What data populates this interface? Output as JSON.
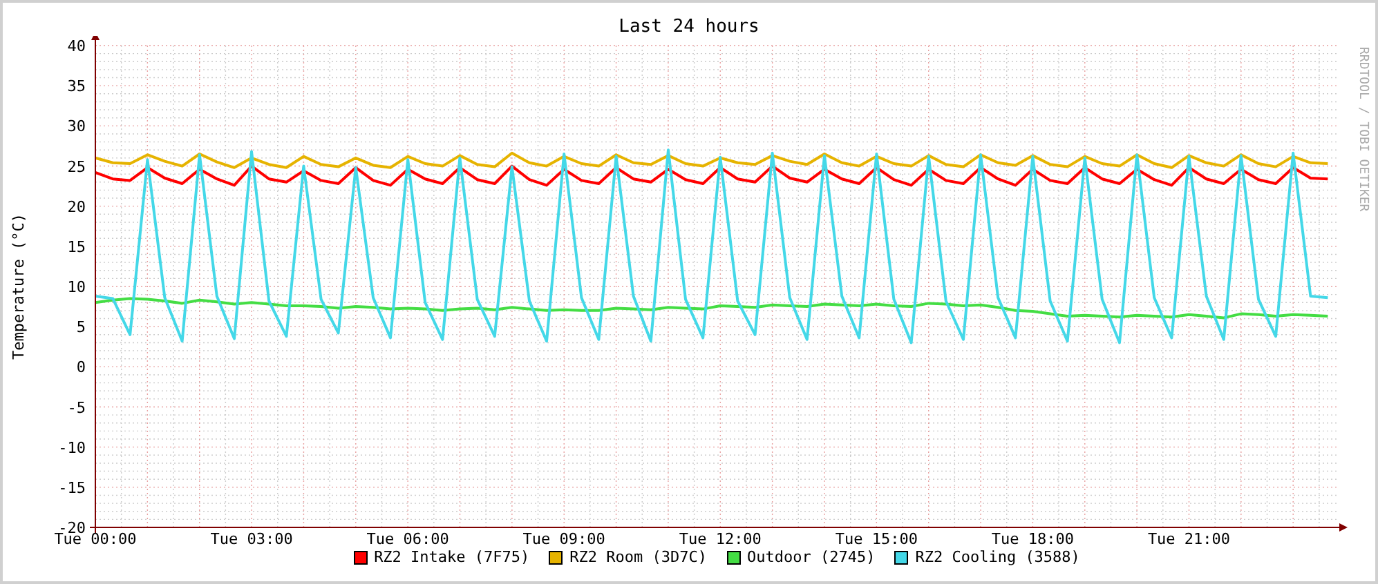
{
  "credit": "RRDTOOL / TOBI OETIKER",
  "chart_data": {
    "type": "line",
    "title": "Last 24 hours",
    "ylabel": "Temperature (°C)",
    "ylim": [
      -20,
      40
    ],
    "grid": true,
    "yticks": [
      -20,
      -15,
      -10,
      -5,
      0,
      5,
      10,
      15,
      20,
      25,
      30,
      35,
      40
    ],
    "categories": [
      "Tue 00:00",
      null,
      null,
      null,
      null,
      null,
      null,
      null,
      null,
      "Tue 03:00",
      null,
      null,
      null,
      null,
      null,
      null,
      null,
      null,
      "Tue 06:00",
      null,
      null,
      null,
      null,
      null,
      null,
      null,
      null,
      "Tue 09:00",
      null,
      null,
      null,
      null,
      null,
      null,
      null,
      null,
      "Tue 12:00",
      null,
      null,
      null,
      null,
      null,
      null,
      null,
      null,
      "Tue 15:00",
      null,
      null,
      null,
      null,
      null,
      null,
      null,
      null,
      "Tue 18:00",
      null,
      null,
      null,
      null,
      null,
      null,
      null,
      null,
      "Tue 21:00",
      null,
      null,
      null,
      null,
      null,
      null,
      null,
      null
    ],
    "series": [
      {
        "name": "RZ2 Intake (7F75)",
        "color": "#ff0000",
        "values": [
          24.2,
          23.4,
          23.2,
          24.8,
          23.5,
          22.8,
          24.6,
          23.4,
          22.6,
          25.0,
          23.4,
          23.0,
          24.4,
          23.2,
          22.8,
          24.8,
          23.2,
          22.6,
          24.6,
          23.4,
          22.8,
          24.8,
          23.3,
          22.8,
          25.0,
          23.3,
          22.6,
          24.6,
          23.2,
          22.8,
          24.8,
          23.4,
          23.0,
          24.6,
          23.3,
          22.8,
          24.8,
          23.4,
          23.0,
          25.0,
          23.5,
          23.0,
          24.6,
          23.4,
          22.8,
          24.8,
          23.3,
          22.6,
          24.6,
          23.2,
          22.8,
          24.8,
          23.4,
          22.6,
          24.6,
          23.2,
          22.8,
          24.8,
          23.4,
          22.8,
          24.6,
          23.3,
          22.6,
          24.8,
          23.4,
          22.8,
          24.6,
          23.3,
          22.8,
          24.8,
          23.5,
          23.4
        ]
      },
      {
        "name": "RZ2 Room (3D7C)",
        "color": "#e6b300",
        "values": [
          26.0,
          25.4,
          25.3,
          26.4,
          25.6,
          25.0,
          26.5,
          25.5,
          24.8,
          26.0,
          25.2,
          24.8,
          26.2,
          25.2,
          24.9,
          26.0,
          25.1,
          24.8,
          26.2,
          25.3,
          25.0,
          26.3,
          25.2,
          24.9,
          26.6,
          25.4,
          25.0,
          26.2,
          25.3,
          25.0,
          26.4,
          25.4,
          25.2,
          26.3,
          25.3,
          25.0,
          26.0,
          25.4,
          25.2,
          26.3,
          25.6,
          25.2,
          26.5,
          25.4,
          25.0,
          26.2,
          25.3,
          25.0,
          26.3,
          25.2,
          24.9,
          26.4,
          25.4,
          25.1,
          26.3,
          25.2,
          24.9,
          26.2,
          25.3,
          25.0,
          26.4,
          25.3,
          24.8,
          26.3,
          25.4,
          25.0,
          26.4,
          25.3,
          24.9,
          26.2,
          25.4,
          25.3
        ]
      },
      {
        "name": "Outdoor (2745)",
        "color": "#44dd44",
        "values": [
          8.0,
          8.3,
          8.5,
          8.4,
          8.2,
          7.9,
          8.3,
          8.1,
          7.8,
          8.0,
          7.8,
          7.6,
          7.6,
          7.5,
          7.3,
          7.5,
          7.4,
          7.2,
          7.3,
          7.2,
          7.0,
          7.2,
          7.3,
          7.1,
          7.4,
          7.2,
          7.0,
          7.1,
          7.0,
          7.0,
          7.3,
          7.2,
          7.1,
          7.4,
          7.3,
          7.2,
          7.6,
          7.5,
          7.4,
          7.7,
          7.6,
          7.5,
          7.8,
          7.7,
          7.6,
          7.8,
          7.6,
          7.5,
          7.9,
          7.8,
          7.6,
          7.7,
          7.4,
          7.0,
          6.9,
          6.6,
          6.3,
          6.4,
          6.3,
          6.2,
          6.4,
          6.3,
          6.2,
          6.5,
          6.3,
          6.1,
          6.6,
          6.5,
          6.3,
          6.5,
          6.4,
          6.3
        ]
      },
      {
        "name": "RZ2 Cooling (3588)",
        "color": "#44d8e8",
        "values": [
          8.8,
          8.5,
          4.0,
          25.8,
          8.6,
          3.2,
          26.4,
          8.8,
          3.5,
          26.8,
          8.2,
          3.8,
          25.0,
          8.4,
          4.2,
          24.8,
          8.6,
          3.6,
          25.8,
          8.0,
          3.4,
          26.0,
          8.4,
          3.8,
          24.9,
          8.2,
          3.2,
          26.5,
          8.6,
          3.4,
          26.2,
          8.8,
          3.2,
          27.0,
          8.4,
          3.6,
          26.1,
          8.2,
          4.0,
          26.6,
          8.6,
          3.4,
          26.3,
          8.8,
          3.6,
          26.5,
          8.4,
          3.0,
          26.2,
          8.2,
          3.4,
          26.4,
          8.6,
          3.6,
          26.2,
          8.2,
          3.2,
          26.0,
          8.4,
          3.0,
          26.4,
          8.6,
          3.6,
          26.2,
          8.8,
          3.4,
          26.3,
          8.4,
          3.8,
          26.6,
          8.8,
          8.6
        ]
      }
    ]
  }
}
